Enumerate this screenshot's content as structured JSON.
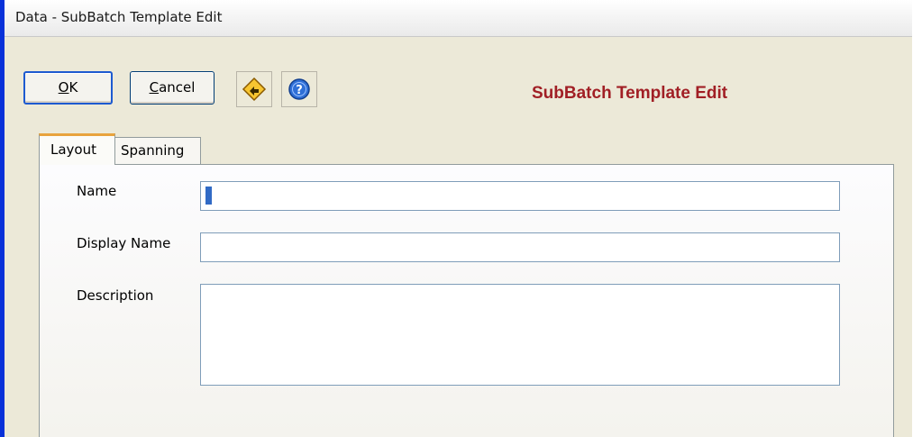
{
  "window": {
    "title": "Data - SubBatch Template Edit",
    "accent_color": "#0831d9",
    "background": "#ece9d8"
  },
  "toolbar": {
    "ok_label_underlined": "O",
    "ok_label_rest": "K",
    "cancel_label_underlined": "C",
    "cancel_label_rest": "ancel",
    "nav_icon": "yellow-diamond-arrow-icon",
    "help_icon": "help-question-icon"
  },
  "heading": {
    "text": "SubBatch Template Edit",
    "color": "#a11f25"
  },
  "tabs": [
    {
      "label": "Layout",
      "active": true
    },
    {
      "label": "Spanning",
      "active": false
    }
  ],
  "form": {
    "name": {
      "label": "Name",
      "value": "",
      "placeholder": ""
    },
    "display_name": {
      "label": "Display Name",
      "value": "",
      "placeholder": ""
    },
    "description": {
      "label": "Description",
      "value": "",
      "placeholder": ""
    }
  }
}
